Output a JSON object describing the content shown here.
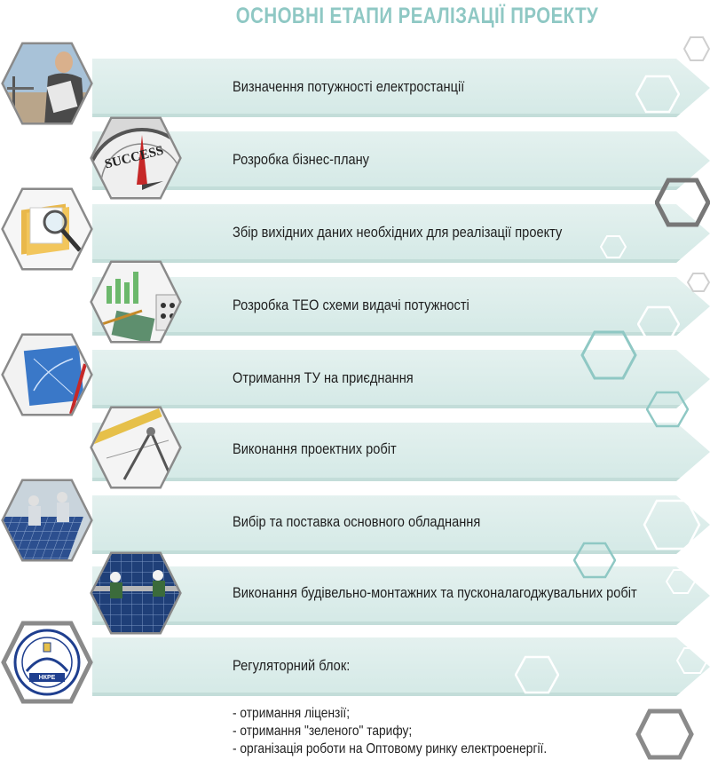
{
  "title": "ОСНОВНІ ЕТАПИ РЕАЛІЗАЦІЇ ПРОЕКТУ",
  "colors": {
    "title": "#8fc8c4",
    "banner": "#dcede9",
    "hex_border": "#8a8a8a"
  },
  "steps": [
    {
      "label": "Визначення потужності електростанції",
      "icon": "engineer-icon"
    },
    {
      "label": "Розробка бізнес-плану",
      "icon": "compass-success-icon"
    },
    {
      "label": "Збір вихідних даних необхідних для реалізації проекту",
      "icon": "folders-magnifier-icon"
    },
    {
      "label": "Розробка ТЕО схеми видачі потужності",
      "icon": "charts-calculator-icon"
    },
    {
      "label": "Отримання ТУ на приєднання",
      "icon": "blueprint-icon"
    },
    {
      "label": "Виконання проектних робіт",
      "icon": "drafting-tools-icon"
    },
    {
      "label": "Вибір та поставка основного обладнання",
      "icon": "solar-panel-workers-icon"
    },
    {
      "label": "Виконання будівельно-монтажних та пусконалагоджувальних робіт",
      "icon": "installation-icon"
    },
    {
      "label": "Регуляторний блок:",
      "icon": "nkre-seal-icon"
    }
  ],
  "nkre_seal_text": "НКРЕ",
  "regulatory_items": [
    "- отримання ліцензії;",
    "- отримання \"зеленого\" тарифу;",
    "- організація роботи на Оптовому ринку електроенергії."
  ]
}
